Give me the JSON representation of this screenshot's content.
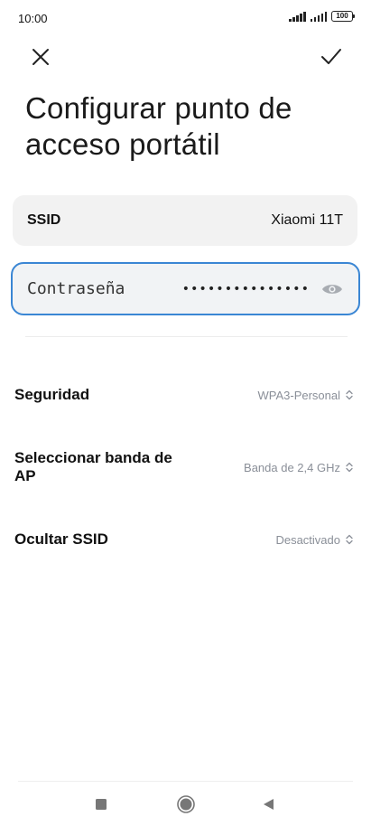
{
  "status_bar": {
    "time": "10:00",
    "battery": "100"
  },
  "toolbar": {
    "close_icon": "close-icon",
    "confirm_icon": "checkmark-icon"
  },
  "page": {
    "title": "Configurar punto de acceso portátil"
  },
  "ssid": {
    "label": "SSID",
    "value": "Xiaomi 11T"
  },
  "password": {
    "label": "Contraseña",
    "value": "•••••••••••••••",
    "icon": "eye-icon"
  },
  "settings": [
    {
      "label": "Seguridad",
      "value": "WPA3-Personal"
    },
    {
      "label": "Seleccionar banda de AP",
      "value": "Banda de 2,4 GHz"
    },
    {
      "label": "Ocultar SSID",
      "value": "Desactivado"
    }
  ],
  "colors": {
    "accent": "#3a86d4",
    "value_gray": "#8a8f98",
    "field_bg": "#f2f2f2"
  },
  "nav": {
    "recents_icon": "square-icon",
    "home_icon": "circle-icon",
    "back_icon": "triangle-back-icon"
  }
}
